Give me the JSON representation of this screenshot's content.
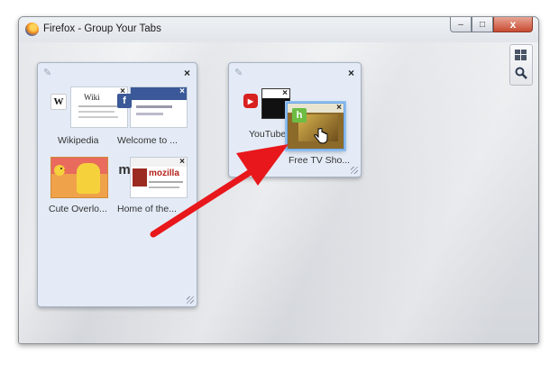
{
  "window": {
    "title": "Firefox - Group Your Tabs",
    "close_glyph": "x",
    "minimize_glyph": "–",
    "maximize_glyph": "□"
  },
  "side_tools": {
    "group_icon": "tab-groups-icon",
    "search_icon": "search-icon"
  },
  "groups": [
    {
      "tabs": [
        {
          "title": "Wikipedia",
          "favicon_text": "W"
        },
        {
          "title": "Welcome to ...",
          "favicon_text": "f"
        },
        {
          "title": "Cute Overlo...",
          "favicon_text": ""
        },
        {
          "title": "Home of the...",
          "favicon_text": "m"
        }
      ]
    },
    {
      "tabs": [
        {
          "title": "YouTube",
          "favicon_text": "▶"
        },
        {
          "title": "Free TV Sho...",
          "favicon_text": "h"
        }
      ]
    }
  ],
  "thumbs": {
    "wiki_text": "Wiki",
    "mozilla_text": "mozilla"
  },
  "accent": {
    "arrow_color": "#e8171b",
    "drag_highlight": "#8fbef0"
  }
}
